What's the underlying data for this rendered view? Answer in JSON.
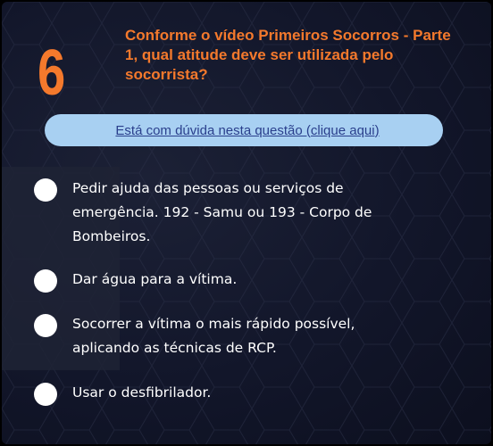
{
  "question": {
    "number": "6",
    "text": "Conforme o vídeo Primeiros Socorros - Parte 1, qual atitude deve ser utilizada pelo socorrista?"
  },
  "help": {
    "label": "Está com dúvida nesta questão (clique aqui)"
  },
  "options": [
    {
      "label": "Pedir ajuda das pessoas ou serviços de emergência. 192 - Samu ou 193 - Corpo de Bombeiros."
    },
    {
      "label": "Dar água para a vítima."
    },
    {
      "label": "Socorrer a vítima o mais rápido possível, aplicando as técnicas de RCP."
    },
    {
      "label": "Usar o desfibrilador."
    }
  ],
  "colors": {
    "accent": "#f4792c",
    "help_bar": "#a8d0f2",
    "help_text": "#2a3f8c",
    "background": "#12162a",
    "option_text": "#ffffff"
  }
}
